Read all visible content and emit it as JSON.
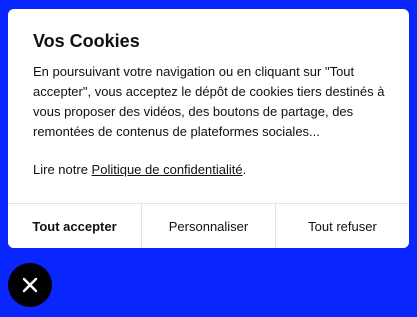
{
  "cookie_banner": {
    "title": "Vos Cookies",
    "description": "En poursuivant votre navigation ou en cliquant sur \"Tout accepter\", vous acceptez le dépôt de cookies tiers destinés à vous proposer des vidéos, des boutons de partage, des remontées de contenus de plateformes sociales...",
    "policy_prefix": "Lire notre ",
    "policy_link": "Politique de confidentialité",
    "policy_suffix": ".",
    "buttons": {
      "accept_all": "Tout accepter",
      "customize": "Personnaliser",
      "refuse_all": "Tout refuser"
    }
  },
  "close_button": {
    "icon": "close-icon"
  },
  "colors": {
    "background": "#0a26ff",
    "card": "#ffffff",
    "text": "#111111",
    "close_button": "#000000"
  }
}
